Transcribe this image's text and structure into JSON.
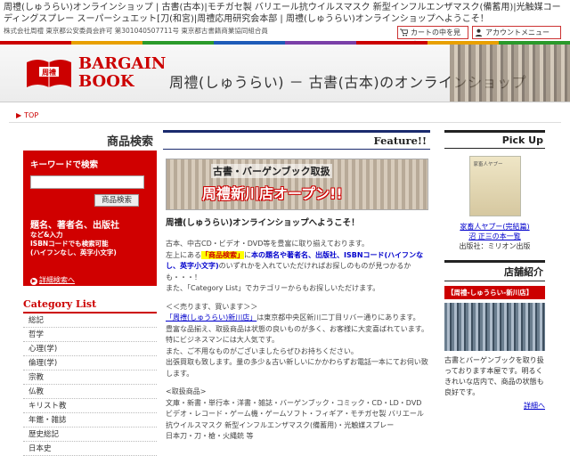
{
  "top_keywords": "周禮(しゅうらい)オンラインショップ | 古書(古本)|モチガセ製 バリエール抗ウイルスマスク 新型インフルエンザマスク(備蓄用)|光触媒コーディングスプレー スーパーシュエット[刀(和宮)|周禮応用研究会本部 | 周禮(しゅうらい)オンラインショップへようこそ！",
  "company_line": "株式会社周禮 東京都公安委員会許可 第301040507711号 東京都古書籍商業協同組合員",
  "header_buttons": {
    "cart": "カートの中を見る",
    "account": "アカウントメニュー"
  },
  "colors": {
    "accent": "#c00000",
    "navy": "#1a2a6e"
  },
  "logo": {
    "line1": "BARGAIN",
    "line2": "BOOK",
    "book_mark": "周禮"
  },
  "header_title": "周禮(しゅうらい) － 古書(古本)のオンラインショップ",
  "breadcrumb": "TOP",
  "left": {
    "search_heading": "商品検索",
    "keyword_label": "キーワードで検索",
    "search_button": "商品検索",
    "field_label": "題名、著者名、出版社",
    "note1": "など&入力",
    "note2": "ISBNコードでも検索可能",
    "note3": "(ハイフンなし、英字小文字)",
    "detail_link": "詳細検索へ",
    "category_heading": "Category List",
    "categories": [
      "総記",
      "哲学",
      "心理(学)",
      "倫理(学)",
      "宗教",
      "仏教",
      "キリスト教",
      "年鑑・雑誌",
      "歴史総記",
      "日本史"
    ]
  },
  "center": {
    "feature_heading": "Feature!!",
    "banner_line1": "古書・バーゲンブック取扱",
    "banner_line2": "周禮新川店オープン!!",
    "welcome": "周禮(しゅうらい)オンラインショップへようこそ！",
    "p1_a": "古本、中古CD・ビデオ・DVD等を豊富に取り揃えております。",
    "p1_b": "左上にある",
    "p1_hl": "「商品検索」",
    "p1_c": "に",
    "p1_blue": "本の題名や著者名、出版社、ISBNコード(ハイフンなし、英字小文字)",
    "p1_d": "のいずれかを入れていただければお探しのものが見つかるかも・・・！",
    "p1_e": "また、「Category List」でカテゴリーからもお探しいただけます。",
    "p2_head": "＜＜売ります、買います＞＞",
    "p2_link": "「周禮(しゅうらい)新川店」",
    "p2_a": "は東京都中央区新川二丁目リバー通りにあります。",
    "p2_b": "豊富な品揃え、取扱商品は状態の良いものが多く、お客様に大変喜ばれています。特にビジネスマンには大人気です。",
    "p2_c": "また、ご不用なものがございましたらぜひお持ちください。",
    "p2_d": "出張買取も致します。量の多少＆古い新しいにかかわらずお電話一本にてお伺い致します。",
    "p3_head": "<取扱商品>",
    "p3_a": "文庫・新書・単行本・洋書・雑誌・バーゲンブック・コミック・CD・LD・DVD",
    "p3_b": "ビデオ・レコード・ゲーム機・ゲームソフト・フィギア・モチガセ製 バリエール抗ウイルスマスク 新型インフルエンザマスク(備蓄用)・光触媒スプレー",
    "p3_c": "日本刀・刀・槍・火縄銃 等"
  },
  "right": {
    "pickup_heading": "Pick Up",
    "pick_cover": "家畜人ヤプー",
    "pick_title": "家畜人ヤプー(完結篇)",
    "pick_author_name": "沼 正三",
    "pick_author_suffix": "の本一覧",
    "pick_publisher": "出版社：ミリオン出版",
    "shop_heading": "店舗紹介",
    "shop_badge": "【周禮-しゅうらい-新川店】",
    "shop_text": "古書とバーゲンブックを取り扱っております本屋です。明るくきれいな店内で、商品の状態も良好です。",
    "shop_detail": "詳細へ"
  }
}
